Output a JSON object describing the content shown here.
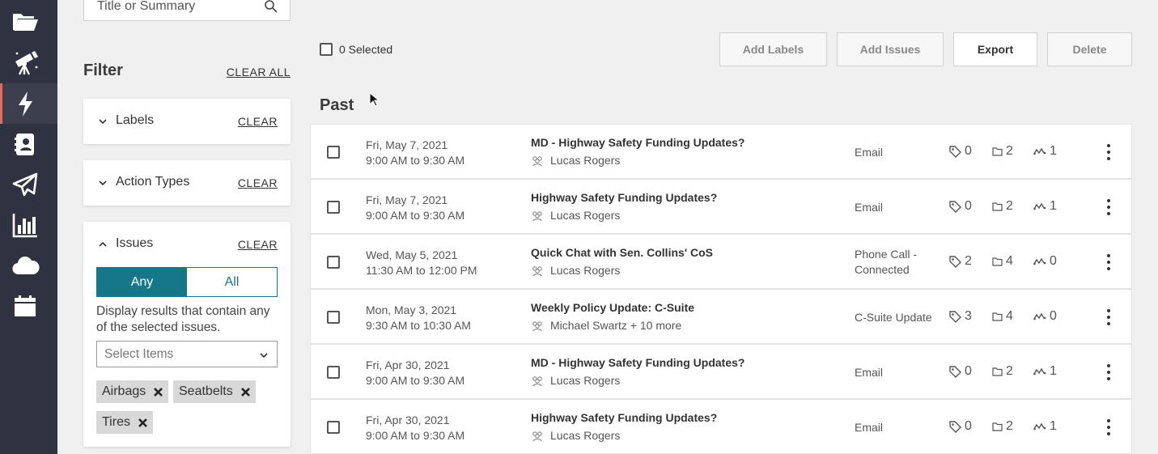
{
  "sidebar": {
    "items": [
      {
        "icon": "folder-open-icon"
      },
      {
        "icon": "telescope-icon"
      },
      {
        "icon": "lightning-icon",
        "active": true
      },
      {
        "icon": "contacts-book-icon"
      },
      {
        "icon": "paper-plane-icon"
      },
      {
        "icon": "bar-chart-icon"
      },
      {
        "icon": "cloud-icon"
      },
      {
        "icon": "calendar-icon"
      }
    ],
    "colors": {
      "background": "#2f3240",
      "active_accent": "#e36b59"
    }
  },
  "search": {
    "placeholder": "Title or Summary"
  },
  "filter": {
    "title": "Filter",
    "clear_all": "CLEAR ALL",
    "sections": {
      "labels": {
        "label": "Labels",
        "clear": "CLEAR"
      },
      "action_types": {
        "label": "Action Types",
        "clear": "CLEAR"
      },
      "issues": {
        "label": "Issues",
        "clear": "CLEAR",
        "toggle_any": "Any",
        "toggle_all": "All",
        "description": "Display results that contain any of the selected issues.",
        "select_placeholder": "Select Items",
        "chips": [
          "Airbags",
          "Seatbelts",
          "Tires"
        ]
      }
    },
    "accent_color": "#17778a"
  },
  "toolbar": {
    "selected_label": "0 Selected",
    "add_labels": "Add Labels",
    "add_issues": "Add Issues",
    "export": "Export",
    "delete": "Delete"
  },
  "section_title": "Past",
  "rows": [
    {
      "date": "Fri, May 7, 2021",
      "time": "9:00 AM to 9:30 AM",
      "title": "MD - Highway Safety Funding Updates?",
      "people": "Lucas Rogers",
      "type_line1": "Email",
      "type_line2": "",
      "labels": "0",
      "issues": "2",
      "links": "1"
    },
    {
      "date": "Fri, May 7, 2021",
      "time": "9:00 AM to 9:30 AM",
      "title": "Highway Safety Funding Updates?",
      "people": "Lucas Rogers",
      "type_line1": "Email",
      "type_line2": "",
      "labels": "0",
      "issues": "2",
      "links": "1"
    },
    {
      "date": "Wed, May 5, 2021",
      "time": "11:30 AM to 12:00 PM",
      "title": "Quick Chat with Sen. Collins' CoS",
      "people": "Lucas Rogers",
      "type_line1": "Phone Call -",
      "type_line2": "Connected",
      "labels": "2",
      "issues": "4",
      "links": "0"
    },
    {
      "date": "Mon, May 3, 2021",
      "time": "9:30 AM to 10:30 AM",
      "title": "Weekly Policy Update: C-Suite",
      "people": "Michael Swartz + 10 more",
      "type_line1": "C-Suite Update",
      "type_line2": "",
      "labels": "3",
      "issues": "4",
      "links": "0"
    },
    {
      "date": "Fri, Apr 30, 2021",
      "time": "9:00 AM to 9:30 AM",
      "title": "MD - Highway Safety Funding Updates?",
      "people": "Lucas Rogers",
      "type_line1": "Email",
      "type_line2": "",
      "labels": "0",
      "issues": "2",
      "links": "1"
    },
    {
      "date": "Fri, Apr 30, 2021",
      "time": "9:00 AM to 9:30 AM",
      "title": "Highway Safety Funding Updates?",
      "people": "Lucas Rogers",
      "type_line1": "Email",
      "type_line2": "",
      "labels": "0",
      "issues": "2",
      "links": "1"
    }
  ]
}
